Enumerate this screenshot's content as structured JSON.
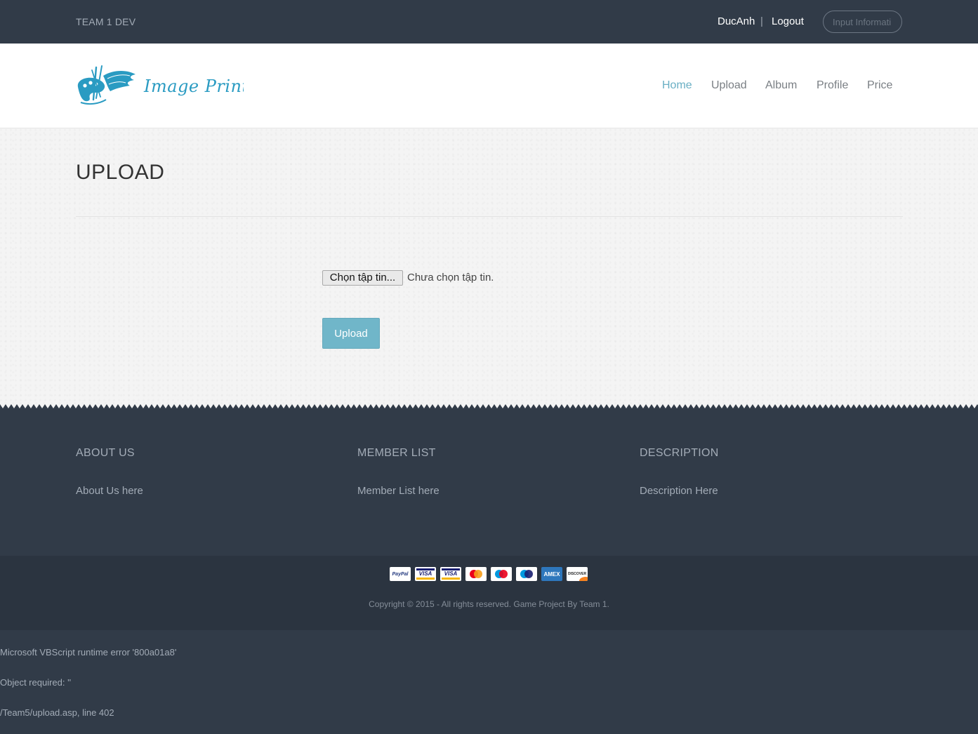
{
  "topbar": {
    "team_name": "TEAM 1 DEV",
    "username": "DucAnh",
    "separator": "|",
    "logout_label": "Logout",
    "input_info_label": "Input Informati"
  },
  "header": {
    "logo_text": "Image Printing",
    "nav": [
      {
        "label": "Home",
        "active": true
      },
      {
        "label": "Upload",
        "active": false
      },
      {
        "label": "Album",
        "active": false
      },
      {
        "label": "Profile",
        "active": false
      },
      {
        "label": "Price",
        "active": false
      }
    ]
  },
  "main": {
    "title": "UPLOAD",
    "file_button_label": "Chọn tập tin...",
    "file_status": "Chưa chọn tập tin.",
    "upload_button_label": "Upload"
  },
  "footer": {
    "columns": [
      {
        "heading": "ABOUT US",
        "text": "About Us here"
      },
      {
        "heading": "MEMBER LIST",
        "text": "Member List here"
      },
      {
        "heading": "DESCRIPTION",
        "text": "Description Here"
      }
    ],
    "payment_icons": [
      "paypal-icon",
      "visa-icon",
      "visa-icon",
      "mastercard-icon",
      "maestro-icon",
      "maestro-icon",
      "amex-icon",
      "discover-icon"
    ],
    "paypal_text": "PayPal",
    "visa_text": "VISA",
    "amex_text": "AMEX",
    "discover_text": "DISCOVER",
    "copyright": "Copyright © 2015 - All rights reserved. Game Project By Team 1."
  },
  "error": {
    "line1": "Microsoft VBScript runtime error '800a01a8'",
    "line2": "Object required: ''",
    "line3": "/Team5/upload.asp, line 402"
  },
  "colors": {
    "dark_bg": "#313b48",
    "darker_bg": "#2b3440",
    "accent": "#69afc4",
    "upload_button": "#70b6c9"
  }
}
